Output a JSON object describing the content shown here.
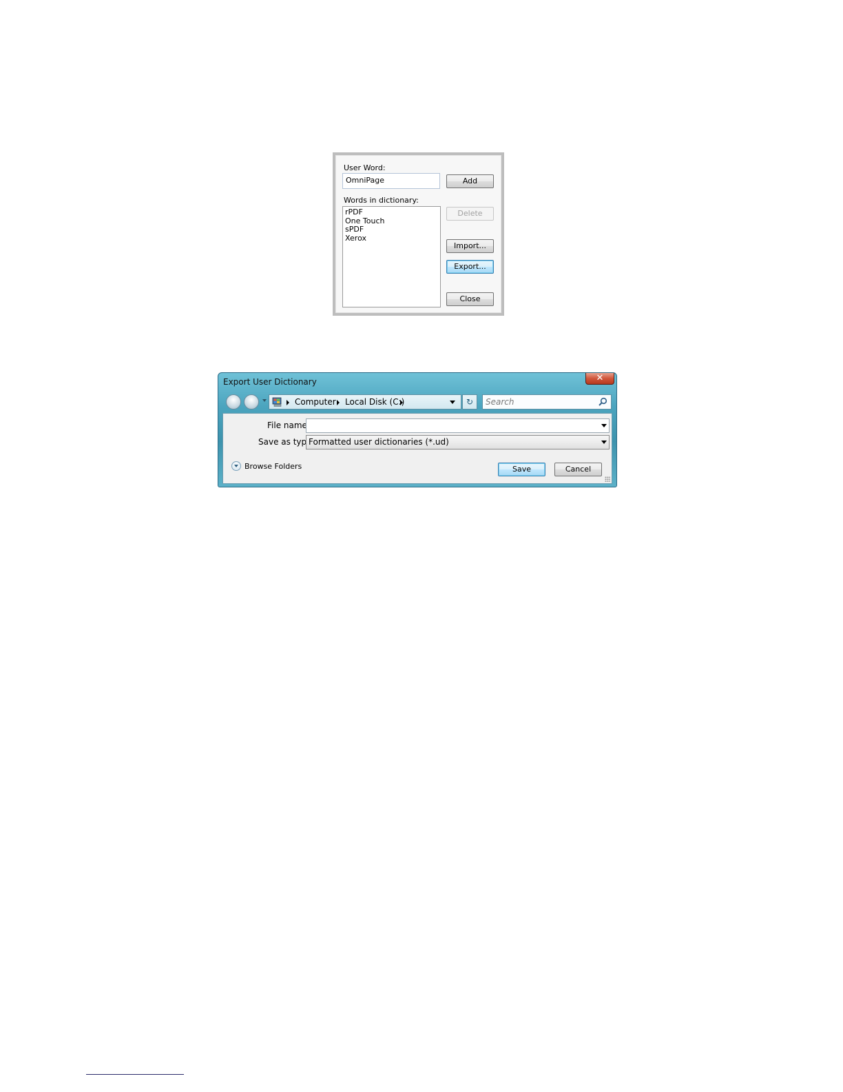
{
  "user_dictionary": {
    "user_word_label": "User Word:",
    "user_word_value": "OmniPage",
    "words_label": "Words in dictionary:",
    "words": [
      "rPDF",
      "One Touch",
      "sPDF",
      "Xerox"
    ],
    "buttons": {
      "add": "Add",
      "delete": "Delete",
      "import": "Import...",
      "export": "Export...",
      "close": "Close"
    }
  },
  "export_dialog": {
    "title": "Export User Dictionary",
    "close_glyph": "✕",
    "breadcrumb": [
      "Computer",
      "Local Disk (C:)"
    ],
    "search_placeholder": "Search",
    "file_name_label": "File name:",
    "file_name_value": "",
    "save_as_type_label": "Save as type:",
    "save_as_type_value": "Formatted user dictionaries (*.ud)",
    "browse_folders_label": "Browse Folders",
    "save_button": "Save",
    "cancel_button": "Cancel",
    "refresh_glyph": "↻"
  },
  "colors": {
    "window_frame": "#4ba4be",
    "close_button": "#c8472c",
    "default_button_border": "#3c7fb1"
  }
}
